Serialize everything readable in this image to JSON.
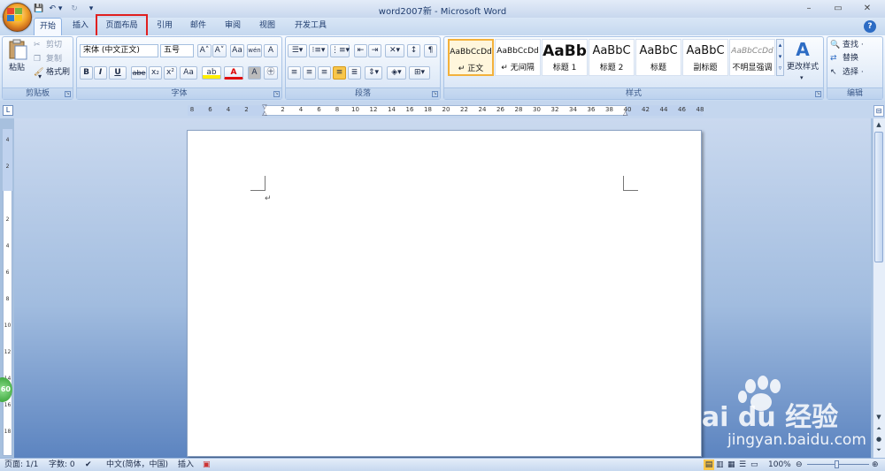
{
  "window": {
    "title": "word2007新 - Microsoft Word",
    "minimize": "–",
    "restore": "▭",
    "close": "✕",
    "help": "?"
  },
  "qat": {
    "save": "💾",
    "undo": "↶ ▾",
    "redo": "↻",
    "customize": "▾"
  },
  "tabs": [
    {
      "label": "开始"
    },
    {
      "label": "插入"
    },
    {
      "label": "页面布局"
    },
    {
      "label": "引用"
    },
    {
      "label": "邮件"
    },
    {
      "label": "审阅"
    },
    {
      "label": "视图"
    },
    {
      "label": "开发工具"
    }
  ],
  "clipboard": {
    "label": "剪贴板",
    "paste": "粘贴",
    "cut": "剪切",
    "copy": "复制",
    "format_painter": "格式刷"
  },
  "font": {
    "label": "字体",
    "name": "宋体 (中文正文)",
    "size": "五号",
    "grow": "A˄",
    "shrink": "A˅",
    "clear": "Aa",
    "phonetic": "wén",
    "border": "A",
    "bold": "B",
    "italic": "I",
    "underline": "U",
    "strike": "abe",
    "sub": "x₂",
    "sup": "x²",
    "case": "Aa",
    "highlight": "ab",
    "color": "A",
    "shading": "A",
    "enclose": "㊉"
  },
  "paragraph": {
    "label": "段落"
  },
  "styles": {
    "label": "样式",
    "change": "更改样式",
    "items": [
      {
        "sample": "AaBbCcDd",
        "name": "↵ 正文"
      },
      {
        "sample": "AaBbCcDd",
        "name": "↵ 无间隔"
      },
      {
        "sample": "AaBb",
        "name": "标题 1"
      },
      {
        "sample": "AaBbC",
        "name": "标题 2"
      },
      {
        "sample": "AaBbC",
        "name": "标题"
      },
      {
        "sample": "AaBbC",
        "name": "副标题"
      },
      {
        "sample": "AaBbCcDd",
        "name": "不明显强调"
      }
    ]
  },
  "editing": {
    "label": "编辑",
    "find": "查找 ·",
    "replace": "替换",
    "select": "选择 ·"
  },
  "ruler": {
    "h_ticks": [
      "8",
      "6",
      "4",
      "2",
      "",
      "2",
      "4",
      "6",
      "8",
      "10",
      "12",
      "14",
      "16",
      "18",
      "20",
      "22",
      "24",
      "26",
      "28",
      "30",
      "32",
      "34",
      "36",
      "38",
      "40",
      "42",
      "44",
      "46",
      "48"
    ],
    "v_ticks": [
      "4",
      "2",
      "",
      "2",
      "4",
      "6",
      "8",
      "10",
      "12",
      "14",
      "16",
      "18"
    ]
  },
  "document": {
    "para_mark": "↵"
  },
  "status": {
    "page": "页面: 1/1",
    "words": "字数: 0",
    "lang": "中文(简体，中国)",
    "mode": "插入",
    "zoom": "100%"
  },
  "watermark": {
    "text": "Bai du 经验",
    "url": "jingyan.baidu.com"
  },
  "badge": "60"
}
